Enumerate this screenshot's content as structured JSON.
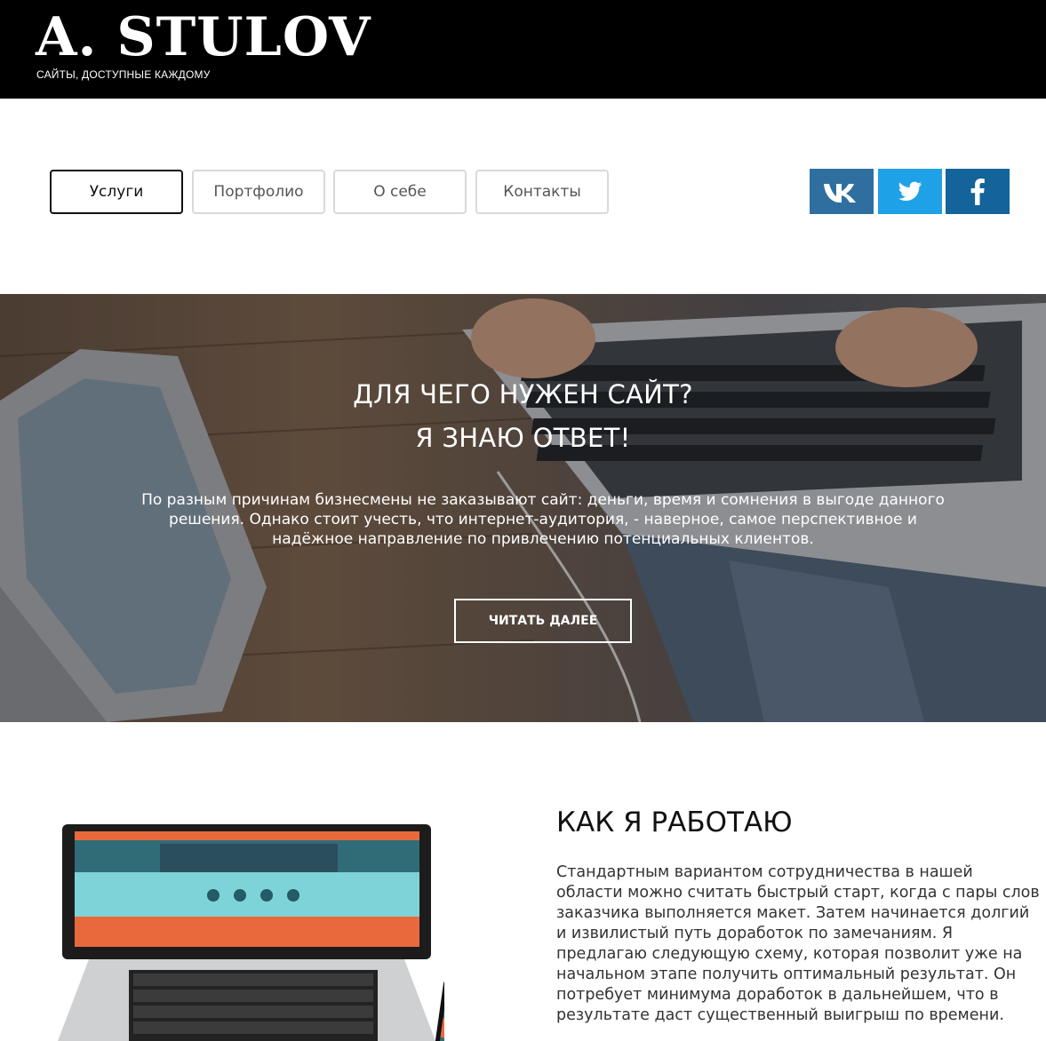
{
  "header": {
    "logo": "A. STULOV",
    "tagline": "САЙТЫ, ДОСТУПНЫЕ КАЖДОМУ"
  },
  "nav": {
    "items": [
      {
        "label": "Услуги",
        "active": true
      },
      {
        "label": "Портфолио",
        "active": false
      },
      {
        "label": "О себе",
        "active": false
      },
      {
        "label": "Контакты",
        "active": false
      }
    ]
  },
  "social": [
    {
      "name": "vk",
      "icon": "vk-icon",
      "color": "#2e6fa0"
    },
    {
      "name": "twitter",
      "icon": "twitter-icon",
      "color": "#1ea1e6"
    },
    {
      "name": "facebook",
      "icon": "facebook-icon",
      "color": "#14639a"
    }
  ],
  "hero": {
    "title_line1": "ДЛЯ ЧЕГО НУЖЕН САЙТ?",
    "title_line2": "Я ЗНАЮ ОТВЕТ!",
    "text": "По разным причинам бизнесмены не заказывают сайт: деньги, время и сомнения в выгоде данного решения. Однако стоит учесть, что интернет-аудитория, - наверное, самое перспективное и надёжное направление по привлечению потенциальных клиентов.",
    "button": "ЧИТАТЬ ДАЛЕЕ"
  },
  "work": {
    "title": "КАК Я РАБОТАЮ",
    "text": "Стандартным вариантом сотрудничества в нашей области можно считать быстрый старт, когда с пары слов заказчика выполняется макет. Затем начинается долгий и извилистый путь доработок по замечаниям. Я предлагаю следующую схему, которая позволит уже на начальном этапе получить оптимальный результат. Он потребует минимума доработок в дальнейшем, что в результате даст существенный выигрыш по времени."
  }
}
